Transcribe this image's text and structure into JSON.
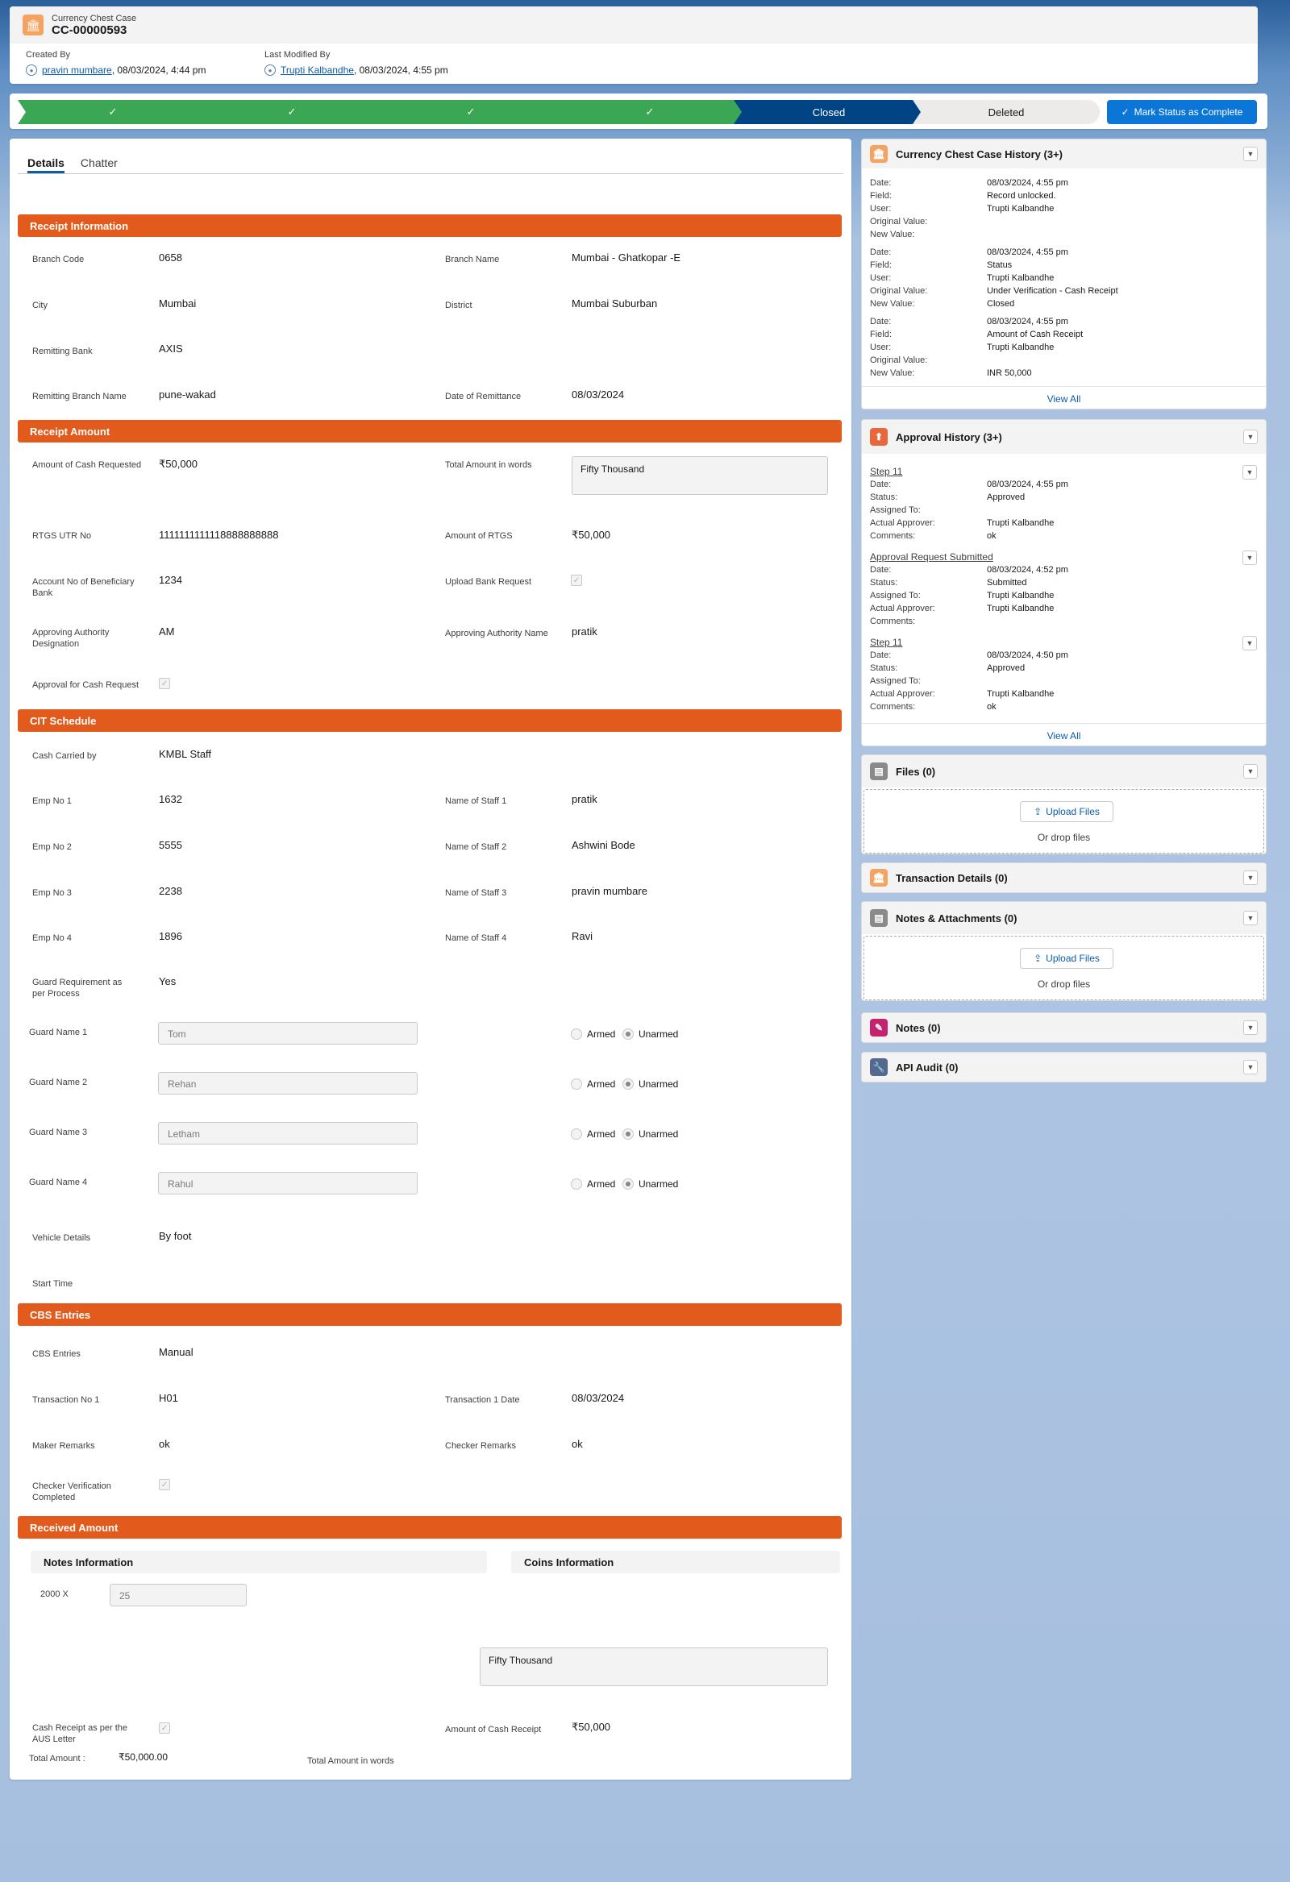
{
  "header": {
    "object_type": "Currency Chest Case",
    "record_name": "CC-00000593",
    "created_by_label": "Created By",
    "created_by_user": "pravin mumbare",
    "created_date": ", 08/03/2024, 4:44 pm",
    "modified_label": "Last Modified By",
    "modified_by_user": "Trupti Kalbandhe",
    "modified_date": ", 08/03/2024, 4:55 pm"
  },
  "path": {
    "closed": "Closed",
    "deleted": "Deleted",
    "mark_button": "Mark Status as Complete",
    "check": "✓"
  },
  "tabs": {
    "details": "Details",
    "chatter": "Chatter"
  },
  "receipt_info": {
    "title": "Receipt Information",
    "branch_code_label": "Branch Code",
    "branch_code": "0658",
    "branch_name_label": "Branch Name",
    "branch_name": "Mumbai - Ghatkopar -E",
    "city_label": "City",
    "city": "Mumbai",
    "district_label": "District",
    "district": "Mumbai Suburban",
    "remitting_bank_label": "Remitting Bank",
    "remitting_bank": "AXIS",
    "remitting_branch_label": "Remitting Branch Name",
    "remitting_branch": "pune-wakad",
    "date_remit_label": "Date of Remittance",
    "date_remit": "08/03/2024"
  },
  "receipt_amount": {
    "title": "Receipt Amount",
    "cash_req_label": "Amount of Cash Requested",
    "cash_req": "₹50,000",
    "words_label": "Total Amount in words",
    "words": "Fifty  Thousand",
    "utr_label": "RTGS UTR No",
    "utr": "1111111111118888888888",
    "rtgs_amt_label": "Amount of RTGS",
    "rtgs_amt": "₹50,000",
    "acct_label": "Account No of Beneficiary Bank",
    "acct": "1234",
    "upload_req_label": "Upload Bank Request",
    "appr_desig_label": "Approving Authority Designation",
    "appr_desig": "AM",
    "appr_name_label": "Approving Authority Name",
    "appr_name": "pratik",
    "approval_cash_label": "Approval for Cash Request"
  },
  "cit": {
    "title": "CIT Schedule",
    "carried_label": "Cash Carried by",
    "carried": "KMBL Staff",
    "emp1_label": "Emp No 1",
    "emp1": "1632",
    "staff1_label": "Name of Staff 1",
    "staff1": "pratik",
    "emp2_label": "Emp No 2",
    "emp2": "5555",
    "staff2_label": "Name of Staff 2",
    "staff2": "Ashwini Bode",
    "emp3_label": "Emp No 3",
    "emp3": "2238",
    "staff3_label": "Name of Staff 3",
    "staff3": "pravin mumbare",
    "emp4_label": "Emp No 4",
    "emp4": "1896",
    "staff4_label": "Name of Staff 4",
    "staff4": "Ravi",
    "guard_req_label": "Guard Requirement as per Process",
    "guard_req": "Yes",
    "guards": [
      {
        "label": "Guard Name 1",
        "value": "Tom"
      },
      {
        "label": "Guard Name 2",
        "value": "Rehan"
      },
      {
        "label": "Guard Name 3",
        "value": "Letham"
      },
      {
        "label": "Guard Name 4",
        "value": "Rahul"
      }
    ],
    "armed": "Armed",
    "unarmed": "Unarmed",
    "vehicle_label": "Vehicle Details",
    "vehicle": "By foot",
    "start_label": "Start Time"
  },
  "cbs": {
    "title": "CBS Entries",
    "entries_label": "CBS Entries",
    "entries": "Manual",
    "txn1_label": "Transaction No 1",
    "txn1": "H01",
    "txn1_date_label": "Transaction 1 Date",
    "txn1_date": "08/03/2024",
    "maker_label": "Maker Remarks",
    "maker": "ok",
    "checker_label": "Checker Remarks",
    "checker": "ok",
    "verif_label": "Checker Verification Completed"
  },
  "received": {
    "title": "Received Amount",
    "notes_info": "Notes Information",
    "coins_info": "Coins Information",
    "denom_label": "2000 X",
    "denom_value": "25",
    "total_label": "Total Amount :",
    "total": "₹50,000.00",
    "words_label": "Total Amount in words",
    "words": "Fifty  Thousand",
    "aus_label": "Cash Receipt as per the AUS Letter",
    "receipt_amt_label": "Amount of Cash Receipt",
    "receipt_amt": "₹50,000"
  },
  "history": {
    "title": "Currency Chest Case History (3+)",
    "k_date": "Date:",
    "k_field": "Field:",
    "k_user": "User:",
    "k_orig": "Original Value:",
    "k_new": "New Value:",
    "entries": [
      {
        "date": "08/03/2024, 4:55 pm",
        "field": "Record unlocked.",
        "user": "Trupti Kalbandhe",
        "orig": "",
        "new": ""
      },
      {
        "date": "08/03/2024, 4:55 pm",
        "field": "Status",
        "user": "Trupti Kalbandhe",
        "orig": "Under Verification - Cash Receipt",
        "new": "Closed"
      },
      {
        "date": "08/03/2024, 4:55 pm",
        "field": "Amount of Cash Receipt",
        "user": "Trupti Kalbandhe",
        "orig": "",
        "new": "INR 50,000"
      }
    ],
    "view_all": "View All"
  },
  "approval": {
    "title": "Approval History (3+)",
    "k_date": "Date:",
    "k_status": "Status:",
    "k_assigned": "Assigned To:",
    "k_actual": "Actual Approver:",
    "k_comments": "Comments:",
    "steps": [
      {
        "name": "Step 11",
        "date": "08/03/2024, 4:55 pm",
        "status": "Approved",
        "assigned": "",
        "actual": "Trupti Kalbandhe",
        "comments": "ok"
      },
      {
        "name": "Approval Request Submitted",
        "date": "08/03/2024, 4:52 pm",
        "status": "Submitted",
        "assigned": "Trupti Kalbandhe",
        "actual": "Trupti Kalbandhe",
        "comments": ""
      },
      {
        "name": "Step 11",
        "date": "08/03/2024, 4:50 pm",
        "status": "Approved",
        "assigned": "",
        "actual": "Trupti Kalbandhe",
        "comments": "ok"
      }
    ],
    "view_all": "View All"
  },
  "files": {
    "title": "Files (0)",
    "upload": "Upload Files",
    "drop": "Or drop files"
  },
  "transactions": {
    "title": "Transaction Details (0)"
  },
  "notes_att": {
    "title": "Notes & Attachments (0)",
    "upload": "Upload Files",
    "drop": "Or drop files"
  },
  "notes": {
    "title": "Notes (0)"
  },
  "api": {
    "title": "API Audit (0)"
  }
}
